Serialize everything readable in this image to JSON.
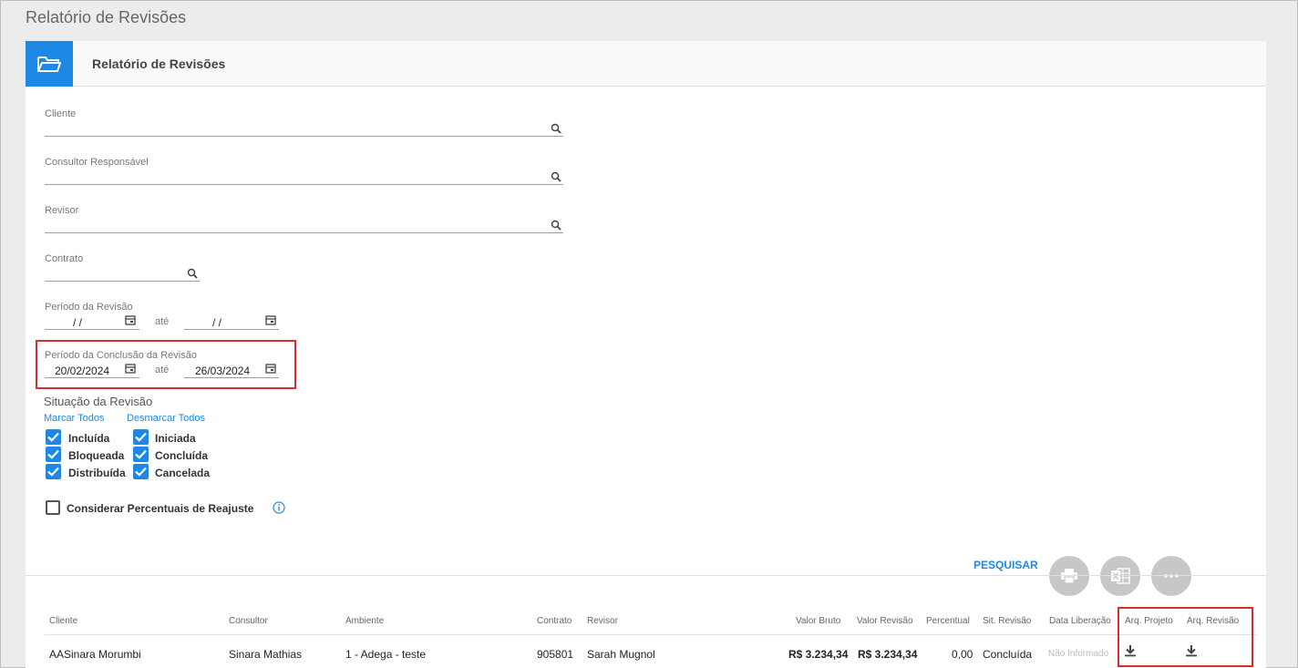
{
  "page": {
    "title": "Relatório de Revisões"
  },
  "card": {
    "title": "Relatório de Revisões"
  },
  "filters": {
    "cliente": {
      "label": "Cliente"
    },
    "consultor": {
      "label": "Consultor Responsável"
    },
    "revisor": {
      "label": "Revisor"
    },
    "contrato": {
      "label": "Contrato"
    },
    "periodo_revisao": {
      "label": "Período da Revisão",
      "from": " /  /",
      "to": " /  /",
      "separator": "até"
    },
    "periodo_conclusao": {
      "label": "Período da Conclusão da Revisão",
      "from": "20/02/2024",
      "to": "26/03/2024",
      "separator": "até"
    }
  },
  "situacao": {
    "title": "Situação da Revisão",
    "marcar_todos": "Marcar Todos",
    "desmarcar_todos": "Desmarcar Todos",
    "options": [
      {
        "label": "Incluída",
        "checked": true
      },
      {
        "label": "Iniciada",
        "checked": true
      },
      {
        "label": "Bloqueada",
        "checked": true
      },
      {
        "label": "Concluída",
        "checked": true
      },
      {
        "label": "Distribuída",
        "checked": true
      },
      {
        "label": "Cancelada",
        "checked": true
      }
    ]
  },
  "reajuste": {
    "label": "Considerar Percentuais de Reajuste",
    "checked": false
  },
  "actions": {
    "search": "PESQUISAR",
    "print_icon": "print-icon",
    "excel_icon": "excel-icon",
    "more_icon": "more-icon"
  },
  "table": {
    "headers": [
      "Cliente",
      "Consultor",
      "Ambiente",
      "Contrato",
      "Revisor",
      "Valor Bruto",
      "Valor Revisão",
      "Percentual",
      "Sit. Revisão",
      "Data Liberação",
      "Arq. Projeto",
      "Arq. Revisão"
    ],
    "rows": [
      {
        "cliente": "AASinara Morumbi",
        "consultor": "Sinara Mathias",
        "ambiente": "1 - Adega - teste",
        "contrato": "905801",
        "revisor": "Sarah Mugnol",
        "valor_bruto": "R$ 3.234,34",
        "valor_revisao": "R$ 3.234,34",
        "percentual": "0,00",
        "situacao": "Concluída",
        "data_liberacao": "Não Informado"
      }
    ]
  },
  "colors": {
    "accent": "#1e88e5",
    "highlight": "#d32f2f"
  }
}
